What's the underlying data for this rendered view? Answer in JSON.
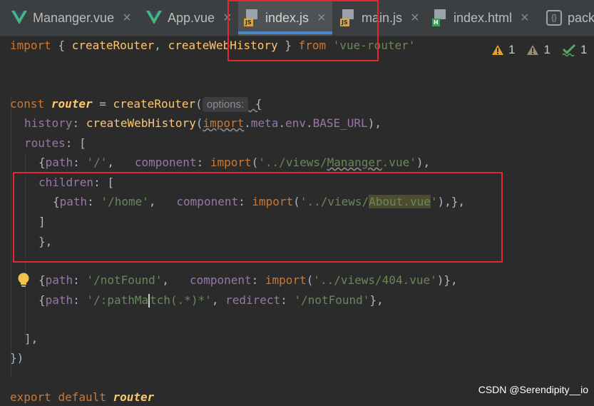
{
  "tabs": [
    {
      "label": "Mananger.vue",
      "icon": "vue-icon",
      "active": false
    },
    {
      "label": "App.vue",
      "icon": "vue-icon",
      "active": false
    },
    {
      "label": "index.js",
      "icon": "js-file-icon",
      "badge": "JS",
      "active": true
    },
    {
      "label": "main.js",
      "icon": "js-file-icon",
      "badge": "JS",
      "active": false
    },
    {
      "label": "index.html",
      "icon": "html-file-icon",
      "badge": "H",
      "active": false
    },
    {
      "label": "packa",
      "icon": "package-json-icon",
      "badge": "{}",
      "active": false
    }
  ],
  "close_glyph": "×",
  "inspections": {
    "warning_count": "1",
    "weak_warning_count": "1",
    "typo_count": "1"
  },
  "code": {
    "l1": {
      "import": "import",
      "brace_open": " { ",
      "createRouter": "createRouter",
      "comma": ", ",
      "createWebHistory": "createWebHistory",
      "brace_close": " } ",
      "from": "from",
      "space": " ",
      "module": "'vue-router'"
    },
    "l2": {
      "const": "const",
      "sp": " ",
      "router": "router",
      "eq": " = ",
      "createRouter": "createRouter",
      "paren": "(",
      "hint": "options:",
      "brace": " {"
    },
    "l3": {
      "history": "history",
      "colon": ": ",
      "createWebHistory": "createWebHistory",
      "paren": "(",
      "import": "import",
      "dot1": ".",
      "meta": "meta",
      "dot2": ".",
      "env": "env",
      "dot3": ".",
      "base": "BASE_URL",
      "end": "),"
    },
    "l4": {
      "routes": "routes",
      "rest": ": ["
    },
    "l5": {
      "open": "{",
      "path": "path",
      "colon1": ": ",
      "val": "'/'",
      "sep": ",   ",
      "component": "component",
      "colon2": ": ",
      "import": "import",
      "paren": "(",
      "q1": "'../views/",
      "file": "Mananger",
      "q2": ".vue'",
      "end": "),"
    },
    "l6": {
      "children": "children",
      "rest": ": ["
    },
    "l7": {
      "open": "{",
      "path": "path",
      "colon1": ": ",
      "val": "'/home'",
      "sep": ",   ",
      "component": "component",
      "colon2": ": ",
      "import": "import",
      "paren": "(",
      "q1": "'../views/",
      "file": "About.vue",
      "q2": "'",
      "end": "),},"
    },
    "l8": "]",
    "l9": "},",
    "l10": {
      "open": "{",
      "path": "path",
      "colon1": ": ",
      "val": "'/notFound'",
      "sep": ",   ",
      "component": "component",
      "colon2": ": ",
      "import": "import",
      "paren": "(",
      "str": "'../views/404.vue'",
      "end": ")},"
    },
    "l11": {
      "open": "{",
      "path": "path",
      "colon1": ": ",
      "val_a": "'/:pathMa",
      "val_b": "tch(.*)*'",
      "sep": ", ",
      "redirect": "redirect",
      "colon2": ": ",
      "val2": "'/notFound'",
      "end": "},"
    },
    "l12": "],",
    "l13": "})",
    "l14": {
      "export": "export",
      "sp1": " ",
      "default": "default",
      "sp2": " ",
      "router": "router"
    }
  },
  "watermark": "CSDN @Serendipity__io",
  "colors": {
    "background": "#2b2b2b",
    "tabbar": "#3c3f41",
    "active_tab": "#4e5254",
    "active_underline": "#4a88c7",
    "annotation_box": "#e0282f",
    "keyword": "#cc7832",
    "function": "#ffc66d",
    "property": "#9876aa",
    "string": "#6a8759",
    "warning": "#e3a22a",
    "ok_check": "#59a869"
  }
}
